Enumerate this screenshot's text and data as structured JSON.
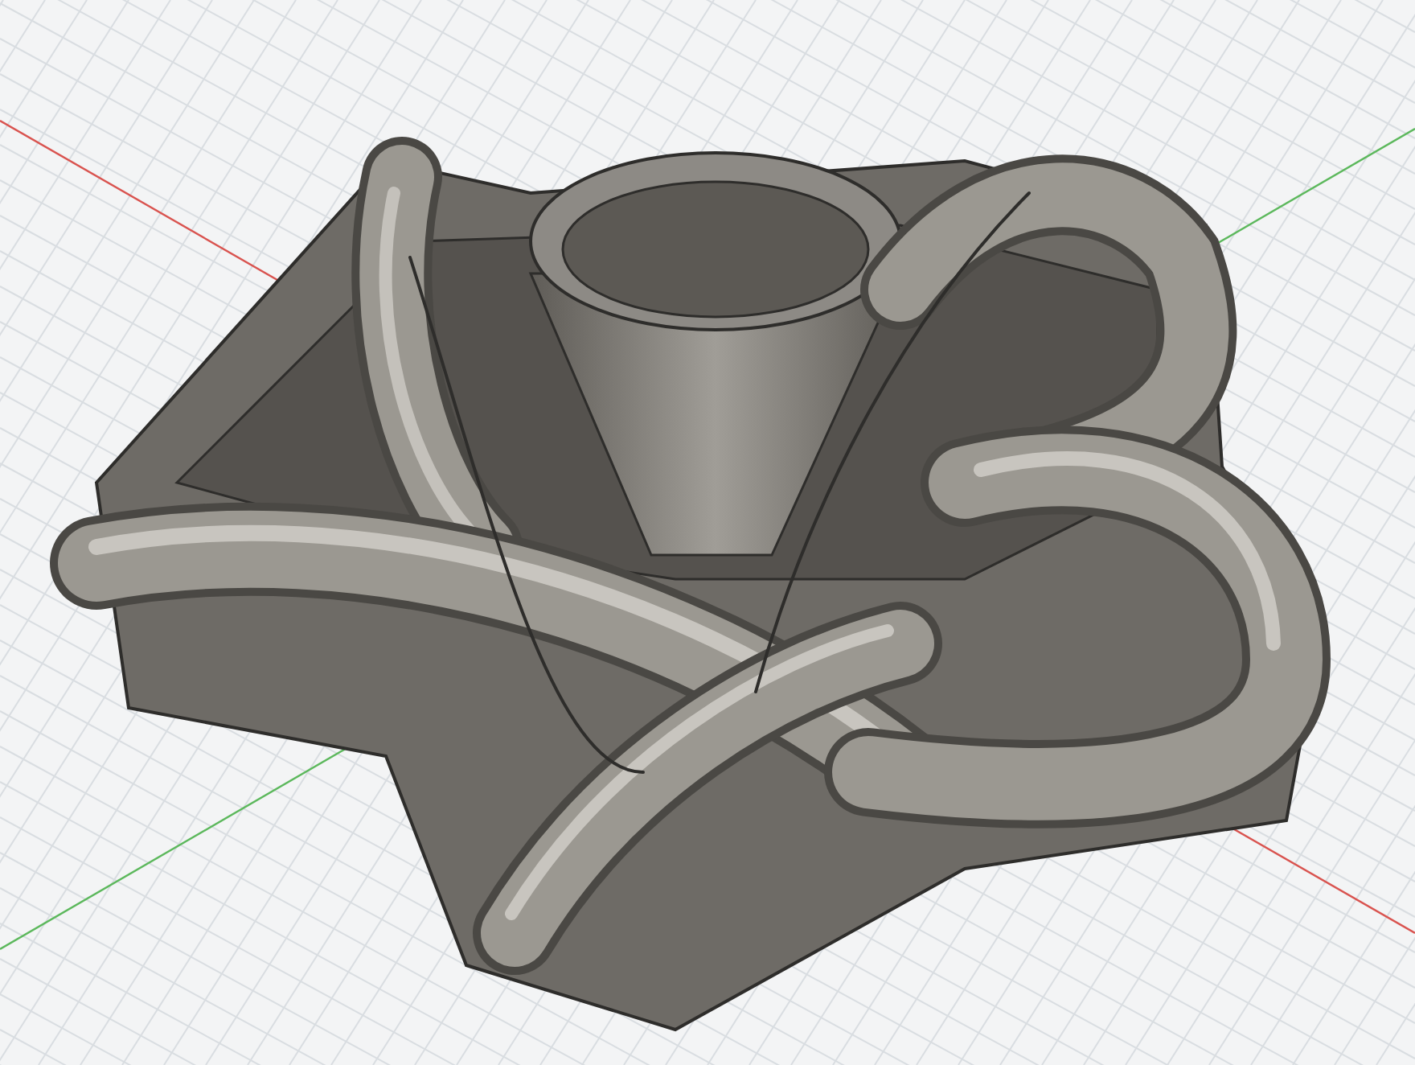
{
  "viewport": {
    "axes": [
      {
        "color": "#d9534f"
      },
      {
        "color": "#5cb85c"
      }
    ]
  }
}
